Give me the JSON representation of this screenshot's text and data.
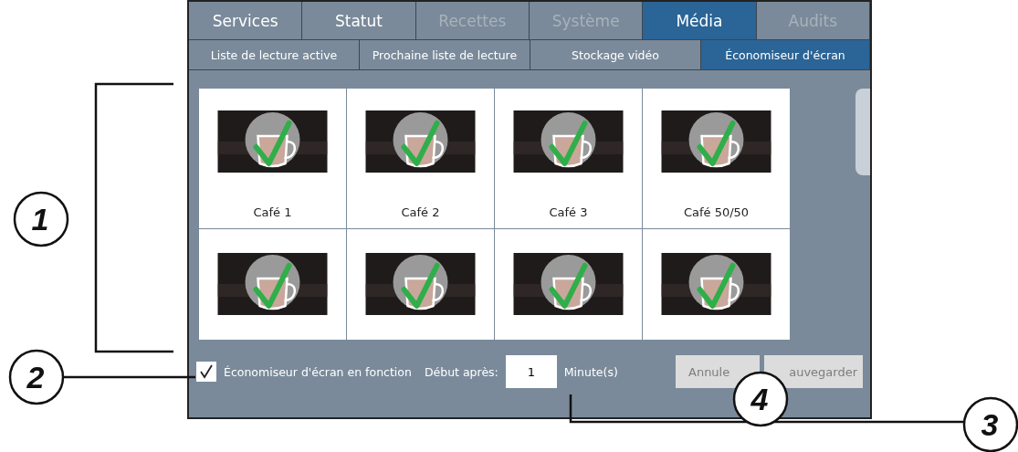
{
  "tabs": [
    {
      "label": "Services",
      "selected": false,
      "disabled": false
    },
    {
      "label": "Statut",
      "selected": false,
      "disabled": false
    },
    {
      "label": "Recettes",
      "selected": false,
      "disabled": true
    },
    {
      "label": "Système",
      "selected": false,
      "disabled": true
    },
    {
      "label": "Média",
      "selected": true,
      "disabled": false
    },
    {
      "label": "Audits",
      "selected": false,
      "disabled": true
    }
  ],
  "subtabs": [
    {
      "label": "Liste de lecture active",
      "selected": false
    },
    {
      "label": "Prochaine liste de lecture",
      "selected": false
    },
    {
      "label": "Stockage vidéo",
      "selected": false
    },
    {
      "label": "Économiseur d'écran",
      "selected": true
    }
  ],
  "screensavers": [
    {
      "kind": "labeled",
      "label": "Café 1"
    },
    {
      "kind": "labeled",
      "label": "Café 2"
    },
    {
      "kind": "labeled",
      "label": "Café 3"
    },
    {
      "kind": "labeled",
      "label": "Café 50/50"
    },
    {
      "kind": "unlabeled"
    },
    {
      "kind": "unlabeled"
    },
    {
      "kind": "unlabeled"
    },
    {
      "kind": "unlabeled"
    }
  ],
  "footer": {
    "enabled_checkbox": {
      "label": "Économiseur d'écran en fonction",
      "checked": true
    },
    "start_after_label": "Début après:",
    "start_after_value": "1",
    "unit": "Minute(s)",
    "buttons": [
      {
        "label": "Annule",
        "disabled": true
      },
      {
        "label": "auvegarder",
        "disabled": true
      }
    ]
  },
  "callouts": [
    {
      "label": "1"
    },
    {
      "label": "2"
    },
    {
      "label": "3"
    },
    {
      "label": "4"
    }
  ]
}
